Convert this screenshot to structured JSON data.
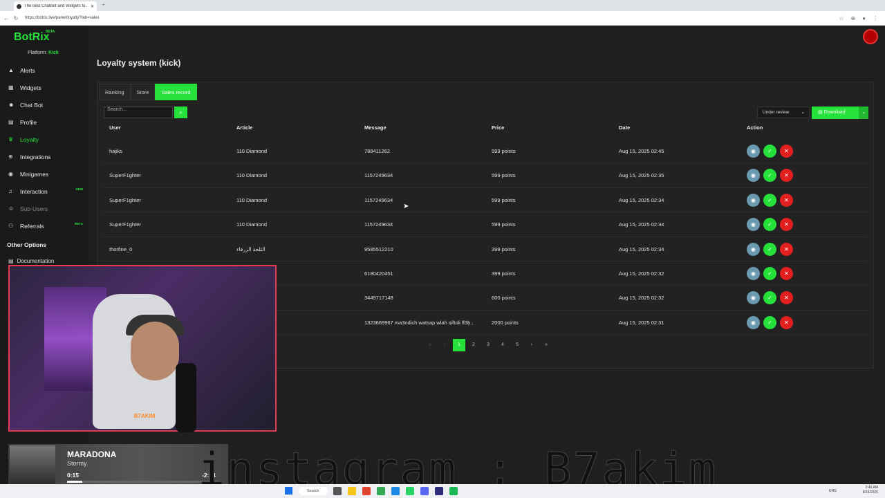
{
  "browser": {
    "tab_title": "The best ChatBot and Widgets fo...",
    "url": "https://botrix.live/panel/loyalty?tab=sales"
  },
  "sidebar": {
    "brand": "BotRix",
    "brand_badge": "BETA",
    "platform_label": "Platform:",
    "platform_value": "Kick",
    "items": [
      {
        "label": "Alerts",
        "icon": "warning-icon",
        "glyph": "▲"
      },
      {
        "label": "Widgets",
        "icon": "widgets-icon",
        "glyph": "▦"
      },
      {
        "label": "Chat Bot",
        "icon": "robot-icon",
        "glyph": "☻"
      },
      {
        "label": "Profile",
        "icon": "profile-icon",
        "glyph": "▤"
      },
      {
        "label": "Loyalty",
        "icon": "trophy-icon",
        "glyph": "♛",
        "active": true
      },
      {
        "label": "Integrations",
        "icon": "integrations-icon",
        "glyph": "⊕"
      },
      {
        "label": "Minigames",
        "icon": "gamepad-icon",
        "glyph": "◉"
      },
      {
        "label": "Interaction",
        "icon": "music-icon",
        "glyph": "♫",
        "badge": "NEW"
      },
      {
        "label": "Sub-Users",
        "icon": "users-icon",
        "glyph": "☺",
        "dim": true
      },
      {
        "label": "Referrals",
        "icon": "referrals-icon",
        "glyph": "⚇",
        "badge": "BETA"
      }
    ],
    "other_options": "Other Options",
    "documentation": "Documentation"
  },
  "main": {
    "title": "Loyalty system (kick)",
    "tabs": [
      "Ranking",
      "Store",
      "Sales record"
    ],
    "active_tab": "Sales record",
    "search_placeholder": "Search...",
    "filter_value": "Under review",
    "download_label": "Download",
    "columns": [
      "User",
      "Article",
      "Message",
      "Price",
      "Date",
      "Action"
    ],
    "rows": [
      {
        "user": "hajiks",
        "article": "110 Diamond",
        "message": "788411262",
        "price": "599 points",
        "date": "Aug 15, 2025 02:45"
      },
      {
        "user": "SuperF1ghter",
        "article": "110 Diamond",
        "message": "1157249634",
        "price": "599 points",
        "date": "Aug 15, 2025 02:35"
      },
      {
        "user": "SuperF1ghter",
        "article": "110 Diamond",
        "message": "1157249634",
        "price": "599 points",
        "date": "Aug 15, 2025 02:34"
      },
      {
        "user": "SuperF1ghter",
        "article": "110 Diamond",
        "message": "1157249634",
        "price": "599 points",
        "date": "Aug 15, 2025 02:34"
      },
      {
        "user": "thorfine_0",
        "article": "الثلجة الزرقاء",
        "message": "9585512210",
        "price": "399 points",
        "date": "Aug 15, 2025 02:34"
      },
      {
        "user": "",
        "article": "",
        "message": "6180420451",
        "price": "399 points",
        "date": "Aug 15, 2025 02:32"
      },
      {
        "user": "",
        "article": "",
        "message": "3449717148",
        "price": "600 points",
        "date": "Aug 15, 2025 02:32"
      },
      {
        "user": "",
        "article": "",
        "message": "1323669967 ma3ndich watsap wlah siftoli ff3b...",
        "price": "2000 points",
        "date": "Aug 15, 2025 02:31"
      }
    ],
    "pagination": {
      "first": "«",
      "prev": "‹",
      "pages": [
        "1",
        "2",
        "3",
        "4",
        "5"
      ],
      "current": "1",
      "next": "›",
      "last": "»"
    }
  },
  "music": {
    "title": "MARADONA",
    "artist": "Stormy",
    "elapsed": "0:15",
    "remaining": "-2:_4",
    "progress": 0.1
  },
  "overlay": "instagram : B7akim",
  "cam_logo": "B7AKIM",
  "taskbar": {
    "search": "Search",
    "lang": "ENG",
    "time": "2:46 AM",
    "date": "8/15/2025"
  },
  "colors": {
    "accent": "#27e13b",
    "danger": "#e32020",
    "view": "#6a99b0"
  }
}
